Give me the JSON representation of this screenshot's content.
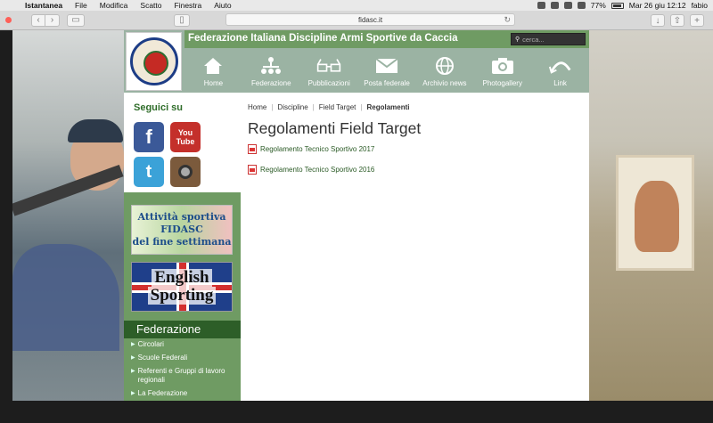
{
  "menubar": {
    "app": "Istantanea",
    "items": [
      "File",
      "Modifica",
      "Scatto",
      "Finestra",
      "Aiuto"
    ],
    "battery": "77%",
    "datetime": "Mar 26 giu  12:12",
    "user": "fabio"
  },
  "browser": {
    "url": "fidasc.it"
  },
  "site": {
    "title": "Federazione Italiana Discipline Armi Sportive da Caccia",
    "search_placeholder": "cerca...",
    "nav": [
      {
        "label": "Home",
        "icon": "home-icon"
      },
      {
        "label": "Federazione",
        "icon": "org-chart-icon"
      },
      {
        "label": "Pubblicazioni",
        "icon": "glasses-icon"
      },
      {
        "label": "Posta federale",
        "icon": "envelope-icon"
      },
      {
        "label": "Archivio news",
        "icon": "globe-icon"
      },
      {
        "label": "Photogallery",
        "icon": "camera-icon"
      },
      {
        "label": "Link",
        "icon": "link-arc-icon"
      }
    ]
  },
  "sidebar": {
    "follow_title": "Seguici su",
    "social": {
      "youtube_top": "You",
      "youtube_bottom": "Tube"
    },
    "banner1": {
      "line1": "Attività sportiva FIDASC",
      "line2": "del fine settimana"
    },
    "banner2": {
      "line1": "English",
      "line2": "Sporting"
    },
    "section_title": "Federazione",
    "links": [
      "Circolari",
      "Scuole Federali",
      "Referenti e Gruppi di lavoro regionali",
      "La Federazione"
    ]
  },
  "content": {
    "breadcrumb": [
      "Home",
      "Discipline",
      "Field Target",
      "Regolamenti"
    ],
    "title": "Regolamenti Field Target",
    "documents": [
      "Regolamento Tecnico Sportivo 2017",
      "Regolamento Tecnico Sportivo 2016"
    ]
  }
}
